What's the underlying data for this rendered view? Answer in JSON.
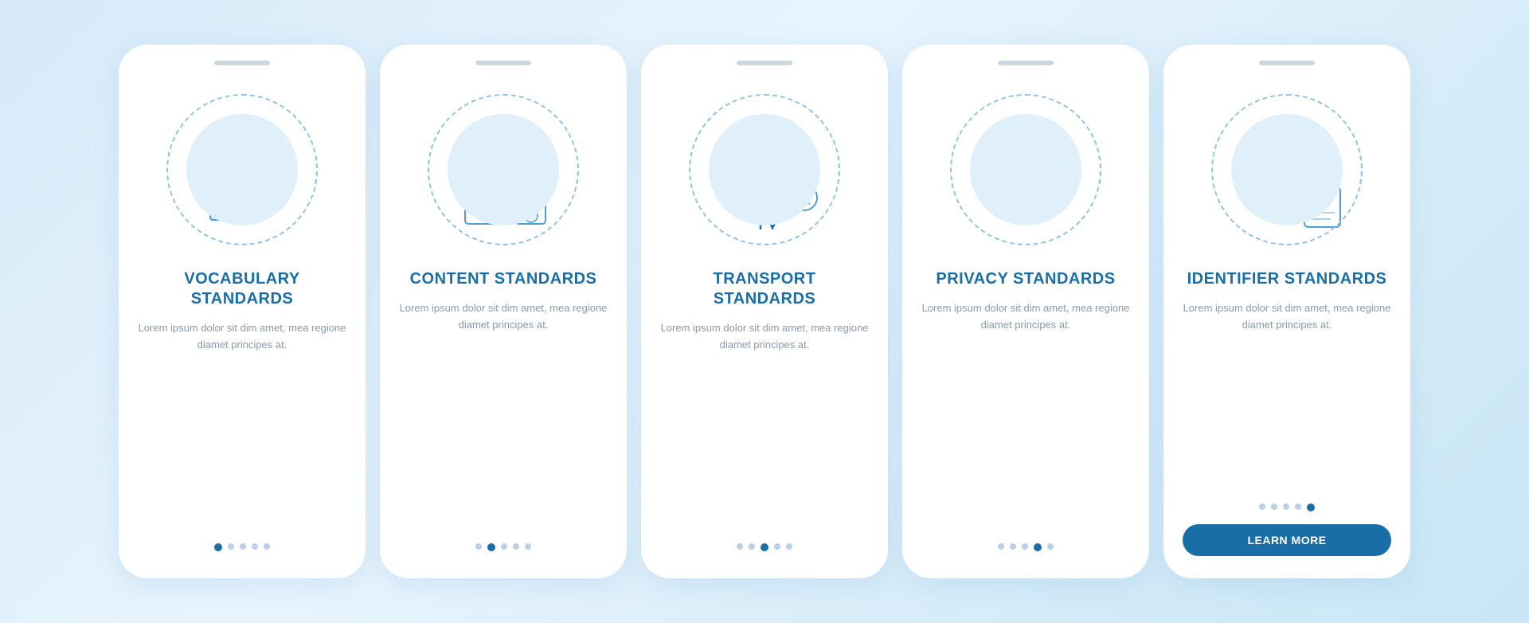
{
  "cards": [
    {
      "id": "vocabulary",
      "title": "VOCABULARY\nSTANDARDS",
      "text": "Lorem ipsum dolor sit dim amet, mea regione diamet principes at.",
      "dots": [
        true,
        false,
        false,
        false,
        false
      ],
      "active_dot": 0,
      "show_button": false,
      "button_label": ""
    },
    {
      "id": "content",
      "title": "CONTENT\nSTANDARDS",
      "text": "Lorem ipsum dolor sit dim amet, mea regione diamet principes at.",
      "dots": [
        false,
        true,
        false,
        false,
        false
      ],
      "active_dot": 1,
      "show_button": false,
      "button_label": ""
    },
    {
      "id": "transport",
      "title": "TRANSPORT\nSTANDARDS",
      "text": "Lorem ipsum dolor sit dim amet, mea regione diamet principes at.",
      "dots": [
        false,
        false,
        true,
        false,
        false
      ],
      "active_dot": 2,
      "show_button": false,
      "button_label": ""
    },
    {
      "id": "privacy",
      "title": "PRIVACY\nSTANDARDS",
      "text": "Lorem ipsum dolor sit dim amet, mea regione diamet principes at.",
      "dots": [
        false,
        false,
        false,
        true,
        false
      ],
      "active_dot": 3,
      "show_button": false,
      "button_label": ""
    },
    {
      "id": "identifier",
      "title": "IDENTIFIER\nSTANDARDS",
      "text": "Lorem ipsum dolor sit dim amet, mea regione diamet principes at.",
      "dots": [
        false,
        false,
        false,
        false,
        true
      ],
      "active_dot": 4,
      "show_button": true,
      "button_label": "LEARN MORE"
    }
  ],
  "colors": {
    "blue_dark": "#1a6ea8",
    "blue_light": "#dff0fb",
    "blue_mid": "#4a9fd4",
    "text_gray": "#8a9bb0"
  }
}
